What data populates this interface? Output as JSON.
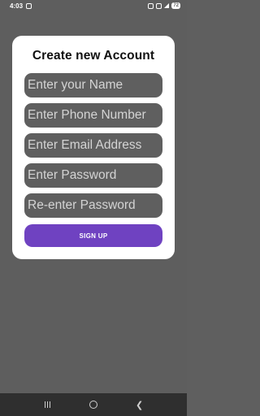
{
  "status_bar": {
    "time": "4:03",
    "battery": "72"
  },
  "form": {
    "title": "Create new Account",
    "name_placeholder": "Enter your Name",
    "phone_placeholder": "Enter Phone Number",
    "email_placeholder": "Enter Email Address",
    "password_placeholder": "Enter Password",
    "confirm_password_placeholder": "Re-enter Password",
    "signup_label": "SIGN UP"
  },
  "colors": {
    "background": "#5e5e5e",
    "card": "#ffffff",
    "field": "#5f5f5f",
    "accent": "#6f42c1"
  },
  "icons": {
    "nav": [
      "recents-icon",
      "home-icon",
      "back-icon"
    ]
  }
}
